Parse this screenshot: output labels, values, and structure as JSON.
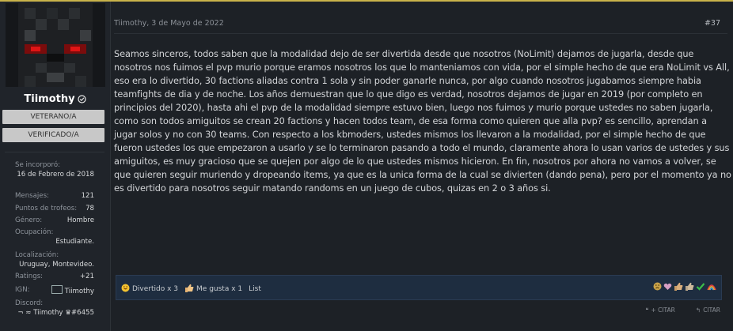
{
  "user": {
    "name": "Tiimothy",
    "banners": [
      "VETERANO/A",
      "VERIFICADO/A"
    ],
    "joined_label": "Se incorporó:",
    "joined_value": "16 de Febrero de 2018",
    "messages_label": "Mensajes:",
    "messages_value": "121",
    "trophy_label": "Puntos de trofeos:",
    "trophy_value": "78",
    "gender_label": "Género:",
    "gender_value": "Hombre",
    "occupation_label": "Ocupación:",
    "occupation_value": "Estudiante.",
    "location_label": "Localización:",
    "location_value": "Uruguay, Montevideo.",
    "ratings_label": "Ratings:",
    "ratings_value": "+21",
    "ign_label": "IGN:",
    "ign_value": "Tiimothy",
    "discord_label": "Discord:",
    "discord_value": "¬ ≈ Tiimothy ♛#6455"
  },
  "post": {
    "date": "Tiimothy, 3 de Mayo de 2022",
    "number": "#37",
    "body": "Seamos sinceros, todos saben que la modalidad dejo de ser divertida desde que nosotros (NoLimit) dejamos de jugarla, desde que nosotros nos fuimos el pvp murio porque eramos nosotros los que lo manteniamos con vida, por el simple hecho de que era NoLimit vs All, eso era lo divertido, 30 factions aliadas contra 1 sola y sin poder ganarle nunca, por algo cuando nosotros jugabamos siempre habia teamfights de dia y de noche. Los años demuestran que lo que digo es verdad, nosotros dejamos de jugar en 2019 (por completo en principios del 2020), hasta ahi el pvp de la modalidad siempre estuvo bien, luego nos fuimos y murio porque ustedes no saben jugarla, como son todos amiguitos se crean 20 factions y hacen todos team, de esa forma como quieren que alla pvp? es sencillo, aprendan a jugar solos y no con 30 teams. Con respecto a los kbmoders, ustedes mismos los llevaron a la modalidad, por el simple hecho de que fueron ustedes los que empezaron a usarlo y se lo terminaron pasando a todo el mundo, claramente ahora lo usan varios de ustedes y sus amiguitos, es muy gracioso que se quejen por algo de lo que ustedes mismos hicieron. En fin, nosotros por ahora no vamos a volver, se que quieren seguir muriendo y dropeando items, ya que es la unica forma de la cual se divierten (dando pena), pero por el momento ya no es divertido para nosotros seguir matando randoms en un juego de cubos, quizas en 2 o 3 años si."
  },
  "reactions": {
    "divertido": "Divertido x 3",
    "megusta": "Me gusta x 1",
    "list": "List"
  },
  "actions": {
    "multiquote": "+ CITAR",
    "quote": "CITAR"
  },
  "colors": {
    "accent_line": "#c9b34a",
    "ratings": "#5fbf3f",
    "react_bar": "#1e2d40"
  }
}
